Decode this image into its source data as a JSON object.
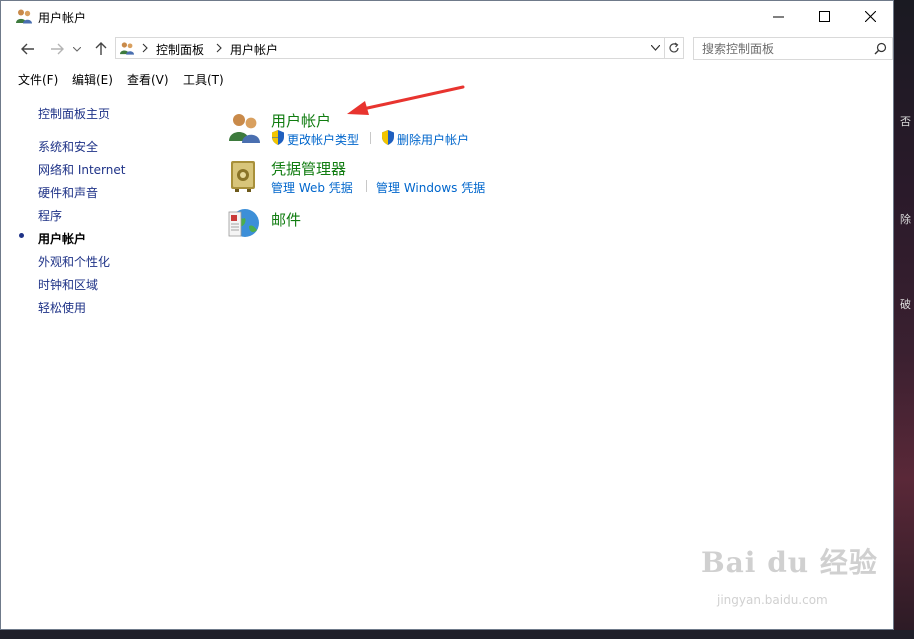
{
  "window": {
    "title": "用户帐户"
  },
  "address_bar": {
    "crumbs": [
      "控制面板",
      "用户帐户"
    ]
  },
  "search": {
    "placeholder": "搜索控制面板"
  },
  "menu": [
    "文件(F)",
    "编辑(E)",
    "查看(V)",
    "工具(T)"
  ],
  "sidebar": {
    "home": "控制面板主页",
    "items": [
      "系统和安全",
      "网络和 Internet",
      "硬件和声音",
      "程序",
      "用户帐户",
      "外观和个性化",
      "时钟和区域",
      "轻松使用"
    ],
    "current_index": 4
  },
  "categories": [
    {
      "title": "用户帐户",
      "links": [
        "更改帐户类型",
        "删除用户帐户"
      ],
      "icon": "users-icon"
    },
    {
      "title": "凭据管理器",
      "links": [
        "管理 Web 凭据",
        "管理 Windows 凭据"
      ],
      "icon": "safe-icon"
    },
    {
      "title": "邮件",
      "links": [],
      "icon": "mail-icon"
    }
  ],
  "desktop_edge": [
    "否",
    "除",
    "破"
  ],
  "watermark": {
    "brand": "Bai du 经验",
    "url": "jingyan.baidu.com"
  },
  "colors": {
    "category_title": "#107c10",
    "link": "#0066cc",
    "sidebar_link": "#1e3287",
    "arrow": "#e8342f"
  }
}
